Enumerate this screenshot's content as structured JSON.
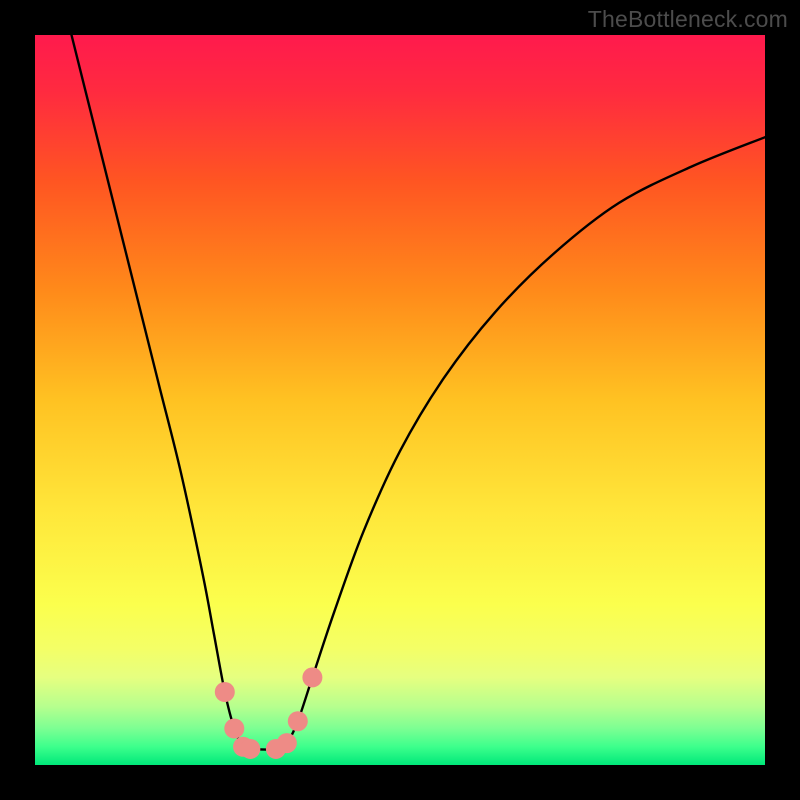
{
  "watermark": "TheBottleneck.com",
  "chart_data": {
    "type": "line",
    "title": "",
    "xlabel": "",
    "ylabel": "",
    "xlim": [
      0,
      100
    ],
    "ylim": [
      0,
      100
    ],
    "gradient_stops": [
      {
        "offset": 0.0,
        "color": "#ff1a4d"
      },
      {
        "offset": 0.08,
        "color": "#ff2b3f"
      },
      {
        "offset": 0.2,
        "color": "#ff5522"
      },
      {
        "offset": 0.35,
        "color": "#ff8a1a"
      },
      {
        "offset": 0.5,
        "color": "#ffc222"
      },
      {
        "offset": 0.65,
        "color": "#ffe63a"
      },
      {
        "offset": 0.78,
        "color": "#fbff4d"
      },
      {
        "offset": 0.84,
        "color": "#f4ff66"
      },
      {
        "offset": 0.88,
        "color": "#e6ff80"
      },
      {
        "offset": 0.92,
        "color": "#b6ff8e"
      },
      {
        "offset": 0.95,
        "color": "#7cff93"
      },
      {
        "offset": 0.975,
        "color": "#3dff8c"
      },
      {
        "offset": 1.0,
        "color": "#00e87a"
      }
    ],
    "series": [
      {
        "name": "bottleneck-curve",
        "x": [
          5,
          8,
          11,
          14,
          17,
          20,
          23,
          24.5,
          26,
          27.3,
          28.5,
          29.5,
          33,
          34.5,
          36,
          38,
          41,
          45,
          50,
          56,
          63,
          71,
          80,
          90,
          100
        ],
        "y": [
          100,
          88,
          76,
          64,
          52,
          40,
          26,
          18,
          10,
          5,
          2.5,
          2.2,
          2.2,
          3,
          6,
          12,
          21,
          32,
          43,
          53,
          62,
          70,
          77,
          82,
          86
        ]
      }
    ],
    "markers": {
      "name": "highlight-markers",
      "color": "#ee8b86",
      "radius_px": 10,
      "points": [
        {
          "x": 26.0,
          "y": 10.0
        },
        {
          "x": 27.3,
          "y": 5.0
        },
        {
          "x": 28.5,
          "y": 2.5
        },
        {
          "x": 29.5,
          "y": 2.2
        },
        {
          "x": 33.0,
          "y": 2.2
        },
        {
          "x": 34.5,
          "y": 3.0
        },
        {
          "x": 36.0,
          "y": 6.0
        },
        {
          "x": 38.0,
          "y": 12.0
        }
      ]
    }
  }
}
